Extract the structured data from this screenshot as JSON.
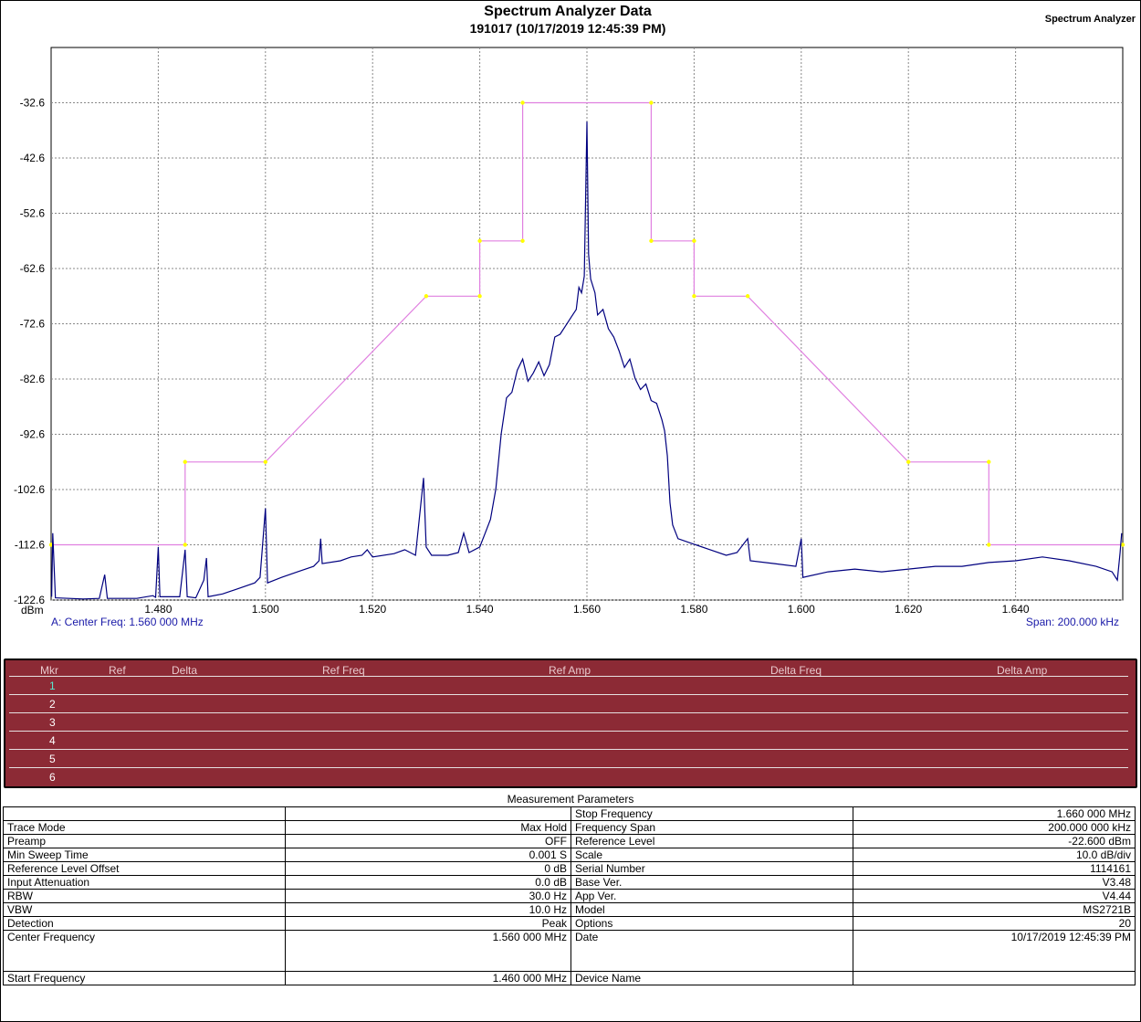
{
  "header": {
    "title": "Spectrum Analyzer Data",
    "subtitle": "191017 (10/17/2019 12:45:39 PM)",
    "app_label": "Spectrum Analyzer"
  },
  "chart_info": {
    "center_freq": "A: Center Freq: 1.560 000 MHz",
    "span": "Span: 200.000 kHz"
  },
  "chart_data": {
    "type": "line",
    "title": "Spectrum Analyzer Data",
    "ylabel": "dBm",
    "xlim": [
      1.46,
      1.66
    ],
    "ylim": [
      -122.6,
      -22.6
    ],
    "x_ticks": [
      "1.480",
      "1.500",
      "1.520",
      "1.540",
      "1.560",
      "1.580",
      "1.600",
      "1.620",
      "1.640"
    ],
    "x_tick_values": [
      1.48,
      1.5,
      1.52,
      1.54,
      1.56,
      1.58,
      1.6,
      1.62,
      1.64
    ],
    "y_ticks": [
      "-32.6",
      "-42.6",
      "-52.6",
      "-62.6",
      "-72.6",
      "-82.6",
      "-92.6",
      "-102.6",
      "-112.6",
      "-122.6"
    ],
    "y_tick_values": [
      -32.6,
      -42.6,
      -52.6,
      -62.6,
      -72.6,
      -82.6,
      -92.6,
      -102.6,
      -112.6,
      -122.6
    ],
    "grid": true,
    "trace_color": "#00007f",
    "limit_color": "#e080e0",
    "limit_point_color": "#ffff00",
    "limit_line": [
      [
        1.46,
        -112.6
      ],
      [
        1.485,
        -112.6
      ],
      [
        1.485,
        -97.6
      ],
      [
        1.5,
        -97.6
      ],
      [
        1.53,
        -67.6
      ],
      [
        1.54,
        -67.6
      ],
      [
        1.54,
        -57.6
      ],
      [
        1.548,
        -57.6
      ],
      [
        1.548,
        -32.6
      ],
      [
        1.572,
        -32.6
      ],
      [
        1.572,
        -57.6
      ],
      [
        1.58,
        -57.6
      ],
      [
        1.58,
        -67.6
      ],
      [
        1.59,
        -67.6
      ],
      [
        1.62,
        -97.6
      ],
      [
        1.635,
        -97.6
      ],
      [
        1.635,
        -112.6
      ],
      [
        1.66,
        -112.6
      ]
    ],
    "trace": [
      [
        1.4601,
        -122.0
      ],
      [
        1.4603,
        -110.5
      ],
      [
        1.4608,
        -122.2
      ],
      [
        1.466,
        -122.4
      ],
      [
        1.469,
        -122.3
      ],
      [
        1.47,
        -118.0
      ],
      [
        1.4705,
        -122.3
      ],
      [
        1.476,
        -122.3
      ],
      [
        1.479,
        -121.8
      ],
      [
        1.4795,
        -122.1
      ],
      [
        1.48,
        -113.0
      ],
      [
        1.4803,
        -122.0
      ],
      [
        1.484,
        -122.0
      ],
      [
        1.485,
        -113.5
      ],
      [
        1.4854,
        -122.0
      ],
      [
        1.487,
        -122.2
      ],
      [
        1.4885,
        -119.0
      ],
      [
        1.489,
        -115.0
      ],
      [
        1.4893,
        -122.0
      ],
      [
        1.492,
        -121.5
      ],
      [
        1.495,
        -120.5
      ],
      [
        1.498,
        -119.5
      ],
      [
        1.499,
        -118.5
      ],
      [
        1.5,
        -106.0
      ],
      [
        1.5004,
        -119.5
      ],
      [
        1.503,
        -118.5
      ],
      [
        1.506,
        -117.5
      ],
      [
        1.509,
        -116.5
      ],
      [
        1.51,
        -115.5
      ],
      [
        1.5103,
        -111.5
      ],
      [
        1.5106,
        -116.0
      ],
      [
        1.514,
        -115.5
      ],
      [
        1.516,
        -114.8
      ],
      [
        1.518,
        -114.5
      ],
      [
        1.519,
        -113.5
      ],
      [
        1.52,
        -114.8
      ],
      [
        1.524,
        -114.2
      ],
      [
        1.526,
        -113.5
      ],
      [
        1.528,
        -114.5
      ],
      [
        1.5295,
        -100.5
      ],
      [
        1.53,
        -113.0
      ],
      [
        1.531,
        -114.5
      ],
      [
        1.534,
        -114.5
      ],
      [
        1.536,
        -114.0
      ],
      [
        1.537,
        -110.5
      ],
      [
        1.538,
        -114.0
      ],
      [
        1.54,
        -113.0
      ],
      [
        1.541,
        -110.5
      ],
      [
        1.542,
        -108.0
      ],
      [
        1.543,
        -102.5
      ],
      [
        1.544,
        -92.5
      ],
      [
        1.545,
        -86.0
      ],
      [
        1.546,
        -85.0
      ],
      [
        1.547,
        -81.0
      ],
      [
        1.548,
        -79.0
      ],
      [
        1.549,
        -83.0
      ],
      [
        1.55,
        -81.5
      ],
      [
        1.551,
        -79.5
      ],
      [
        1.552,
        -82.0
      ],
      [
        1.553,
        -80.0
      ],
      [
        1.554,
        -75.0
      ],
      [
        1.555,
        -74.5
      ],
      [
        1.556,
        -73.0
      ],
      [
        1.557,
        -71.5
      ],
      [
        1.558,
        -70.0
      ],
      [
        1.5585,
        -66.0
      ],
      [
        1.559,
        -67.0
      ],
      [
        1.5595,
        -64.0
      ],
      [
        1.56,
        -36.0
      ],
      [
        1.5603,
        -60.0
      ],
      [
        1.5607,
        -64.5
      ],
      [
        1.5615,
        -67.0
      ],
      [
        1.562,
        -71.0
      ],
      [
        1.563,
        -70.0
      ],
      [
        1.564,
        -73.5
      ],
      [
        1.565,
        -75.0
      ],
      [
        1.566,
        -77.5
      ],
      [
        1.567,
        -80.5
      ],
      [
        1.568,
        -79.0
      ],
      [
        1.569,
        -82.5
      ],
      [
        1.57,
        -84.5
      ],
      [
        1.571,
        -83.5
      ],
      [
        1.572,
        -86.5
      ],
      [
        1.573,
        -87.0
      ],
      [
        1.574,
        -90.0
      ],
      [
        1.5745,
        -92.0
      ],
      [
        1.575,
        -96.5
      ],
      [
        1.5755,
        -105.0
      ],
      [
        1.576,
        -109.0
      ],
      [
        1.577,
        -111.5
      ],
      [
        1.58,
        -112.5
      ],
      [
        1.583,
        -113.5
      ],
      [
        1.586,
        -114.5
      ],
      [
        1.588,
        -114.0
      ],
      [
        1.59,
        -111.5
      ],
      [
        1.5905,
        -115.5
      ],
      [
        1.595,
        -116.0
      ],
      [
        1.599,
        -116.5
      ],
      [
        1.6,
        -111.5
      ],
      [
        1.6003,
        -118.5
      ],
      [
        1.605,
        -117.5
      ],
      [
        1.61,
        -117.0
      ],
      [
        1.615,
        -117.5
      ],
      [
        1.62,
        -117.0
      ],
      [
        1.625,
        -116.5
      ],
      [
        1.63,
        -116.5
      ],
      [
        1.635,
        -115.8
      ],
      [
        1.64,
        -115.5
      ],
      [
        1.645,
        -114.8
      ],
      [
        1.65,
        -115.5
      ],
      [
        1.655,
        -116.5
      ],
      [
        1.658,
        -117.5
      ],
      [
        1.659,
        -119.0
      ],
      [
        1.6595,
        -114.0
      ],
      [
        1.6598,
        -110.5
      ]
    ]
  },
  "markers": {
    "headers": [
      "Mkr",
      "Ref",
      "Delta",
      "Ref Freq",
      "Ref Amp",
      "Delta Freq",
      "Delta Amp"
    ],
    "rows": [
      "1",
      "2",
      "3",
      "4",
      "5",
      "6"
    ]
  },
  "params": {
    "title": "Measurement Parameters",
    "rows": [
      {
        "l": "",
        "v": "",
        "l2": "Stop Frequency",
        "v2": "1.660 000 MHz"
      },
      {
        "l": "Trace Mode",
        "v": "Max Hold",
        "l2": "Frequency Span",
        "v2": "200.000 000 kHz"
      },
      {
        "l": "Preamp",
        "v": "OFF",
        "l2": "Reference Level",
        "v2": "-22.600  dBm"
      },
      {
        "l": "Min Sweep Time",
        "v": "0.001 S",
        "l2": "Scale",
        "v2": "10.0  dB/div"
      },
      {
        "l": "Reference Level Offset",
        "v": "0 dB",
        "l2": "Serial Number",
        "v2": "1114161"
      },
      {
        "l": "Input Attenuation",
        "v": "0.0 dB",
        "l2": "Base Ver.",
        "v2": "V3.48"
      },
      {
        "l": "RBW",
        "v": "30.0 Hz",
        "l2": "App Ver.",
        "v2": "V4.44"
      },
      {
        "l": "VBW",
        "v": "10.0 Hz",
        "l2": "Model",
        "v2": "MS2721B"
      },
      {
        "l": "Detection",
        "v": "Peak",
        "l2": "Options",
        "v2": "20"
      },
      {
        "l": "Center Frequency",
        "v": "1.560 000 MHz",
        "l2": "Date",
        "v2": "10/17/2019 12:45:39 PM"
      },
      {
        "l": "Start Frequency",
        "v": "1.460 000 MHz",
        "l2": "Device Name",
        "v2": ""
      }
    ]
  }
}
